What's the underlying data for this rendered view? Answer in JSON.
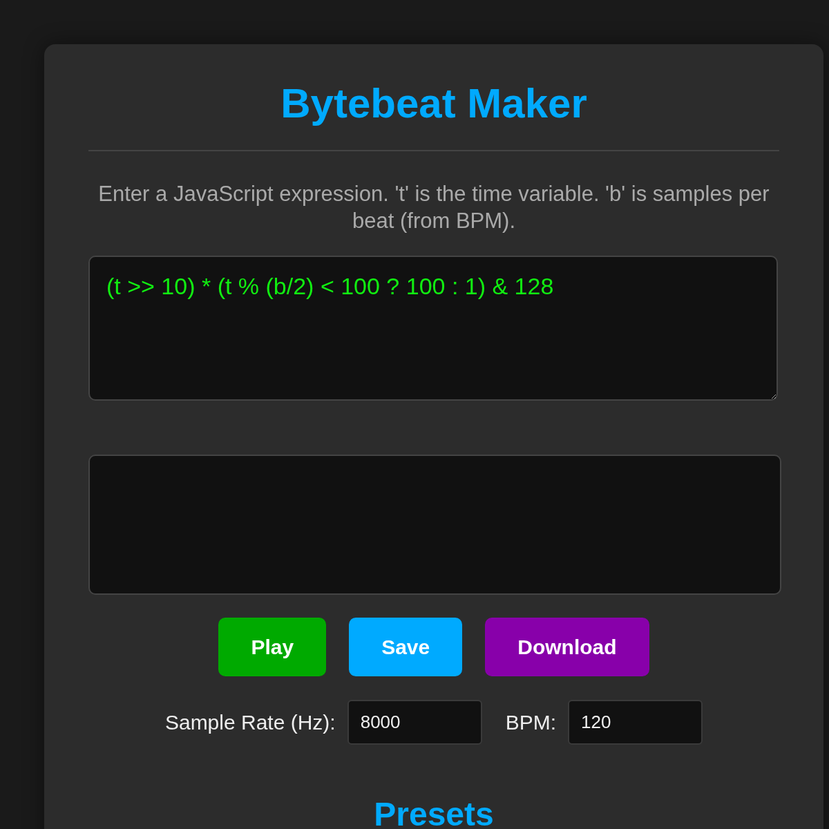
{
  "title": "Bytebeat Maker",
  "description": "Enter a JavaScript expression. 't' is the time variable. 'b' is samples per beat (from BPM).",
  "editor": {
    "value": "(t >> 10) * (t % (b/2) < 100 ? 100 : 1) & 128"
  },
  "buttons": [
    {
      "label": "Play",
      "color": "#00aa00"
    },
    {
      "label": "Save",
      "color": "#00aaff"
    },
    {
      "label": "Download",
      "color": "#8800aa"
    }
  ],
  "settings": [
    {
      "label": "Sample Rate (Hz):",
      "value": "8000"
    },
    {
      "label": "BPM:",
      "value": "120"
    }
  ],
  "presets": {
    "title": "Presets"
  }
}
